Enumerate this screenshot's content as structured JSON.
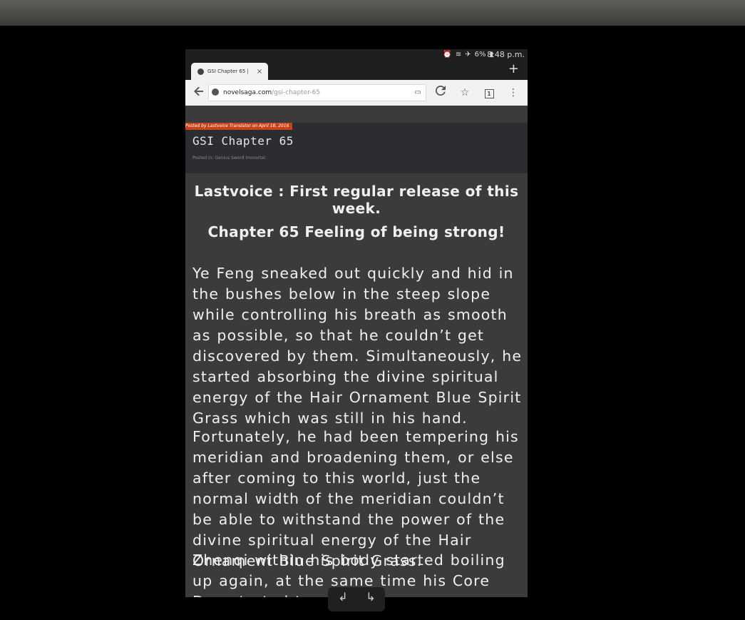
{
  "status_bar": {
    "icons": [
      "alarm-icon",
      "wifi-icon",
      "airplane-icon",
      "battery-icon"
    ],
    "battery": "6%",
    "time": "8:48 p.m."
  },
  "tab": {
    "title": "GSI Chapter 65 |",
    "close_glyph": "×"
  },
  "new_tab_glyph": "+",
  "toolbar": {
    "url_host": "novelsaga.com",
    "url_path": "/gsi-chapter-65",
    "tab_count": "1"
  },
  "post": {
    "posted_by": "Posted by Lastvoice Translator on April 18, 2016",
    "title": "GSI Chapter 65",
    "posted_in": "Posted in: Genius Sword Immortal."
  },
  "article": {
    "intro": "Lastvoice : First regular release of this week.",
    "chapter_title": "Chapter 65 Feeling of being strong!",
    "paragraphs": [
      "Ye Feng sneaked out quickly and hid in the bushes below in the steep slope while controlling his breath as smooth as possible, so that he couldn’t get discovered by them. Simultaneously, he started absorbing the divine spiritual energy of the Hair Ornament Blue Spirit Grass which was still in his hand.",
      "Fortunately, he had been tempering his meridian and broadening them, or else after coming to this world, just the normal width of the meridian couldn’t be able to withstand the power of the divine spiritual energy of the Hair Ornament Blue Spirit Grass.",
      "Zhenqi within his body started boiling up again, at the same time his Core Dan started transforming a"
    ]
  },
  "colors": {
    "page_bg": "#3b3b3b",
    "header_bg": "#2c2d31",
    "posted_by_bg": "#c8431a",
    "toolbar_bg": "#f2f2f2"
  }
}
